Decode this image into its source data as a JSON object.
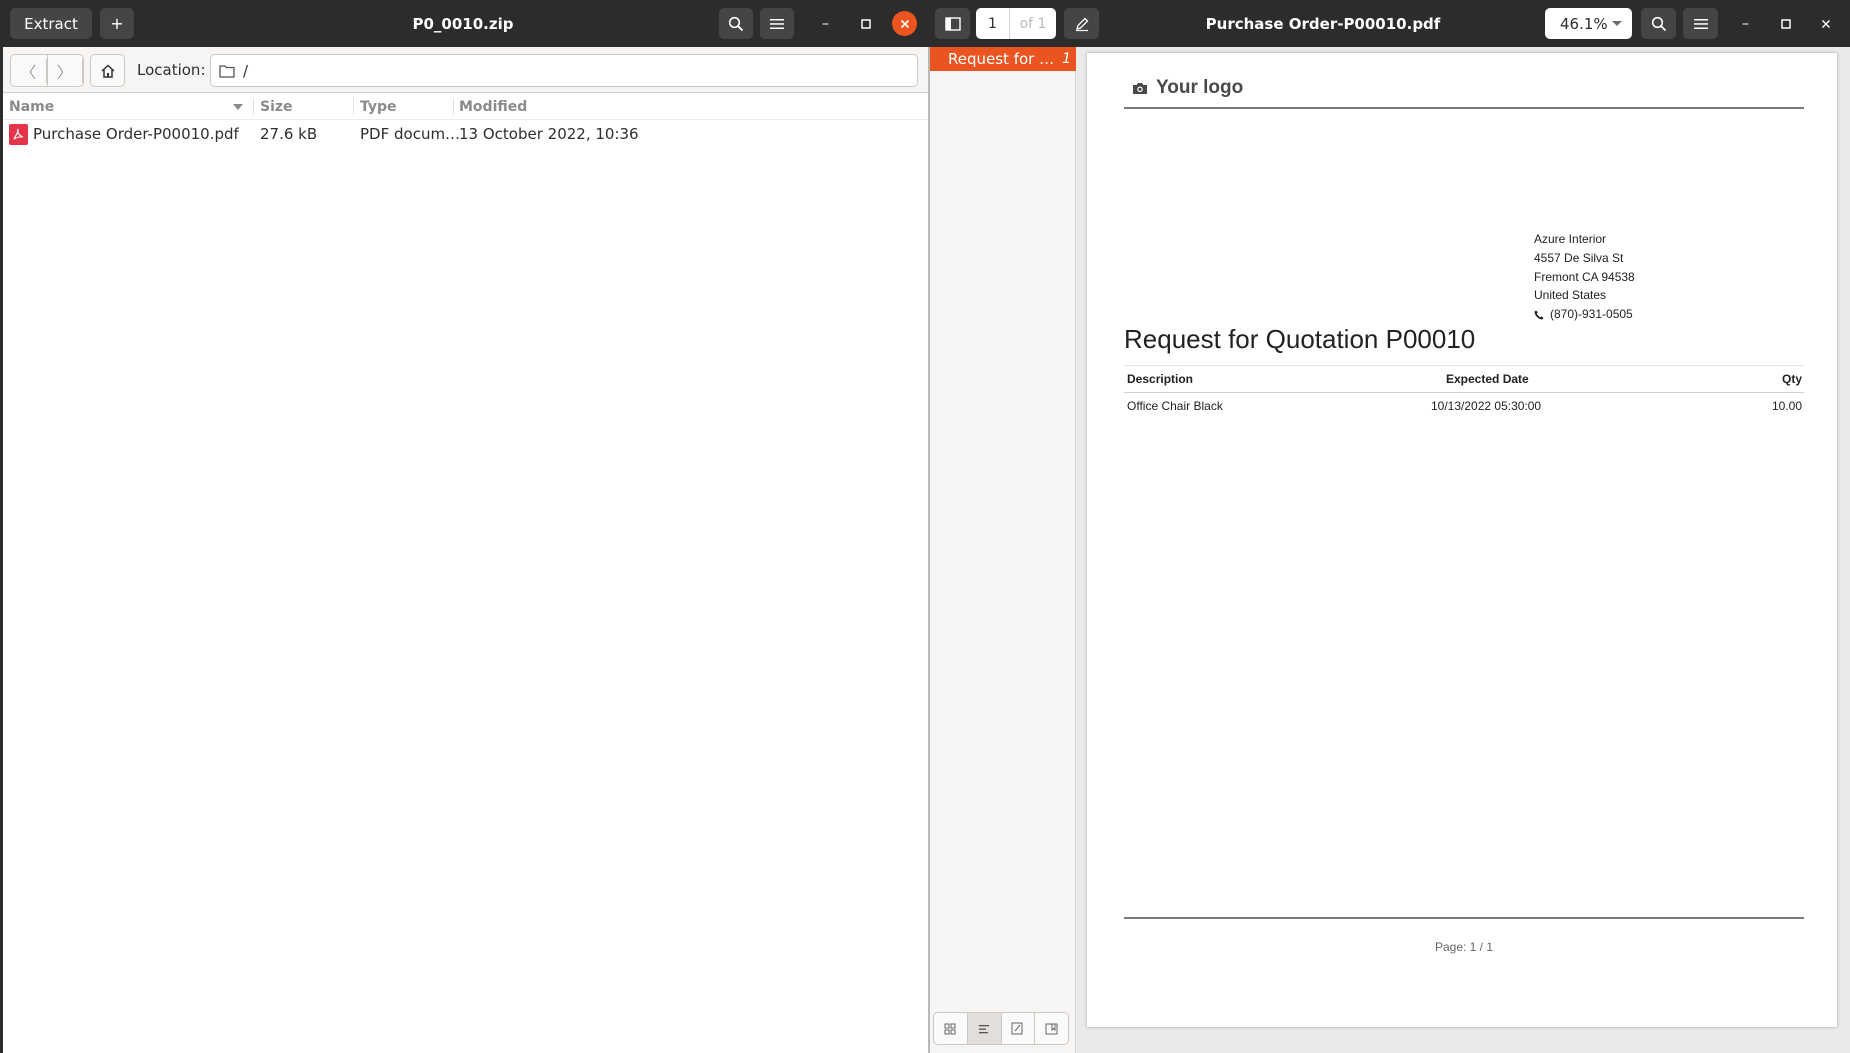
{
  "archive": {
    "title": "P0_0010.zip",
    "extract_label": "Extract",
    "add_label": "+",
    "location_label": "Location:",
    "location_value": "/",
    "columns": {
      "name": "Name",
      "size": "Size",
      "type": "Type",
      "modified": "Modified"
    },
    "files": [
      {
        "name": "Purchase Order-P00010.pdf",
        "size": "27.6 kB",
        "type": "PDF docum…",
        "modified": "13 October 2022, 10:36"
      }
    ]
  },
  "viewer": {
    "title": "Purchase Order-P00010.pdf",
    "page_current": "1",
    "page_of": "of 1",
    "zoom": "46.1%",
    "outline": [
      {
        "label": "Request for …",
        "page": "1"
      }
    ]
  },
  "document": {
    "logo_text": "Your logo",
    "address": [
      "Azure Interior",
      "4557 De Silva St",
      "Fremont CA 94538",
      "United States",
      "(870)-931-0505"
    ],
    "title": "Request for Quotation P00010",
    "table": {
      "headers": {
        "description": "Description",
        "expected_date": "Expected Date",
        "qty": "Qty"
      },
      "rows": [
        {
          "description": "Office Chair Black",
          "expected_date": "10/13/2022 05:30:00",
          "qty": "10.00"
        }
      ]
    },
    "footer": "Page: 1 / 1"
  },
  "colors": {
    "accent": "#e95420",
    "headerbar": "#2c2c2c",
    "pdf_icon": "#e3344a"
  }
}
